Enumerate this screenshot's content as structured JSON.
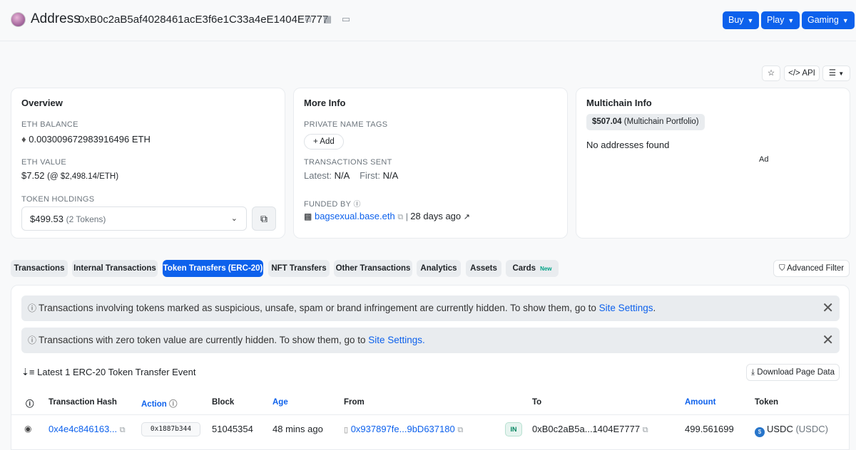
{
  "header": {
    "title": "Address",
    "address": "0xB0c2aB5af4028461acE3f6e1C33a4eE1404E7777",
    "buttons": [
      "Buy",
      "Play",
      "Gaming"
    ]
  },
  "toolbar": {
    "api_label": "API"
  },
  "overview": {
    "title": "Overview",
    "eth_balance_label": "ETH BALANCE",
    "eth_balance": "0.003009672983916496 ETH",
    "eth_value_label": "ETH VALUE",
    "eth_value": "$7.52",
    "eth_price": "(@ $2,498.14/ETH)",
    "token_holdings_label": "TOKEN HOLDINGS",
    "token_holdings_value": "$499.53",
    "token_holdings_count": "(2 Tokens)"
  },
  "more_info": {
    "title": "More Info",
    "private_tags_label": "PRIVATE NAME TAGS",
    "add_label": "+ Add",
    "tx_sent_label": "TRANSACTIONS SENT",
    "latest_label": "Latest:",
    "latest_value": "N/A",
    "first_label": "First:",
    "first_value": "N/A",
    "funded_by_label": "FUNDED BY",
    "funded_by": "bagsexual.base.eth",
    "funded_age": "28 days ago"
  },
  "multichain": {
    "title": "Multichain Info",
    "portfolio_value": "$507.04",
    "portfolio_label": "(Multichain Portfolio)",
    "no_addresses": "No addresses found",
    "ad_label": "Ad"
  },
  "tabs": [
    "Transactions",
    "Internal Transactions",
    "Token Transfers (ERC-20)",
    "NFT Transfers",
    "Other Transactions",
    "Analytics",
    "Assets",
    "Cards"
  ],
  "tab_new_badge": "New",
  "advanced_filter": "Advanced Filter",
  "notices": [
    {
      "text": "Transactions involving tokens marked as suspicious, unsafe, spam or brand infringement are currently hidden. To show them, go to ",
      "link": "Site Settings",
      "end": "."
    },
    {
      "text": "Transactions with zero token value are currently hidden. To show them, go to ",
      "link": "Site Settings.",
      "end": ""
    }
  ],
  "latest_label": "Latest 1 ERC-20 Token Transfer Event",
  "download_label": "Download Page Data",
  "table": {
    "headers": [
      "Transaction Hash",
      "Action",
      "Block",
      "Age",
      "From",
      "To",
      "Amount",
      "Token"
    ],
    "row": {
      "tx_hash": "0x4e4c846163...",
      "method": "0x1887b344",
      "block": "51045354",
      "age": "48 mins ago",
      "from": "0x937897fe...9bD637180",
      "direction": "IN",
      "to": "0xB0c2aB5a...1404E7777",
      "amount": "499.561699",
      "token": "USDC",
      "token_symbol": "(USDC)"
    }
  },
  "colors": {
    "accent": "#0d61ec",
    "background": "#f8f9fa"
  }
}
